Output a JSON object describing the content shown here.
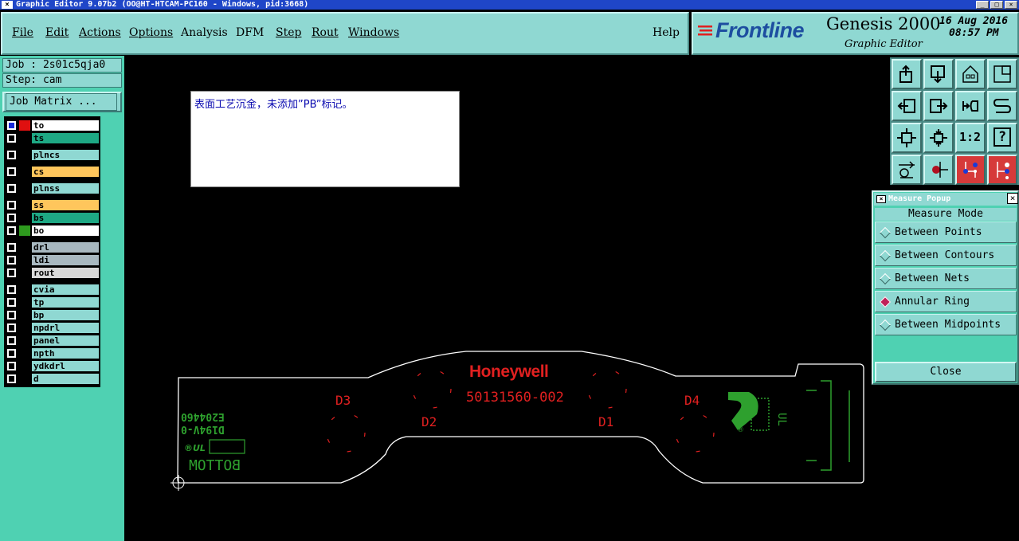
{
  "window": {
    "title": "Graphic Editor 9.07b2 (OO@HT-HTCAM-PC160 - Windows, pid:3668)",
    "controls": [
      "_",
      "□",
      "×"
    ]
  },
  "menu": {
    "items": [
      {
        "label": "File"
      },
      {
        "label": "Edit"
      },
      {
        "label": "Actions"
      },
      {
        "label": "Options"
      },
      {
        "label": "Analysis"
      },
      {
        "label": "DFM"
      },
      {
        "label": "Step"
      },
      {
        "label": "Rout"
      },
      {
        "label": "Windows"
      }
    ],
    "help": "Help"
  },
  "brand": {
    "logo": "Frontline",
    "product": "Genesis 2000",
    "subtitle": "Graphic Editor",
    "date": "16 Aug 2016",
    "time": "08:57 PM"
  },
  "job": {
    "job_label": "Job : 2s01c5qja0",
    "step_label": "Step: cam",
    "matrix_button": "Job Matrix ..."
  },
  "layers": [
    {
      "name": "to",
      "color": "#ffffff",
      "swatch": "#e01010",
      "active": true
    },
    {
      "name": "ts",
      "color": "#1ea884",
      "swatch": ""
    },
    {
      "name": "plncs",
      "color": "#8fd8d2",
      "swatch": ""
    },
    {
      "name": "cs",
      "color": "#ffc65c",
      "swatch": ""
    },
    {
      "name": "plnss",
      "color": "#8fd8d2",
      "swatch": ""
    },
    {
      "name": "ss",
      "color": "#ffc65c",
      "swatch": ""
    },
    {
      "name": "bs",
      "color": "#1ea884",
      "swatch": ""
    },
    {
      "name": "bo",
      "color": "#ffffff",
      "swatch": "#2e9a1e"
    },
    {
      "name": "drl",
      "color": "#a8b8c0",
      "swatch": ""
    },
    {
      "name": "ldi",
      "color": "#a8b8c0",
      "swatch": ""
    },
    {
      "name": "rout",
      "color": "#d8d8d8",
      "swatch": ""
    },
    {
      "name": "cvia",
      "color": "#8fd8d2",
      "swatch": ""
    },
    {
      "name": "tp",
      "color": "#8fd8d2",
      "swatch": ""
    },
    {
      "name": "bp",
      "color": "#8fd8d2",
      "swatch": ""
    },
    {
      "name": "npdrl",
      "color": "#8fd8d2",
      "swatch": ""
    },
    {
      "name": "panel",
      "color": "#8fd8d2",
      "swatch": ""
    },
    {
      "name": "npth",
      "color": "#8fd8d2",
      "swatch": ""
    },
    {
      "name": "ydkdrl",
      "color": "#8fd8d2",
      "swatch": ""
    },
    {
      "name": "d",
      "color": "#8fd8d2",
      "swatch": ""
    }
  ],
  "note": {
    "text": "表面工艺沉金，未添加”PB”标记。"
  },
  "board": {
    "brand_text": "Honeywell",
    "part_number": "50131560-002",
    "ref_d1": "D1",
    "ref_d2": "D2",
    "ref_d3": "D3",
    "ref_d4": "D4",
    "mirror_line1": "E204460",
    "mirror_line2": "D194V-0",
    "mirror_bottom": "BOTTOM",
    "colors": {
      "outline": "#ffffff",
      "silk_top": "#e02020",
      "silk_bottom": "#2ea02e"
    }
  },
  "toolbar": {
    "buttons": [
      {
        "icon": "zoom-home-icon"
      },
      {
        "icon": "zoom-fit-icon"
      },
      {
        "icon": "home-icon"
      },
      {
        "icon": "window-icon"
      },
      {
        "icon": "pan-left-icon"
      },
      {
        "icon": "pan-right-icon"
      },
      {
        "icon": "undo-redo-icon"
      },
      {
        "icon": "swap-icon"
      },
      {
        "icon": "zoom-in-icon"
      },
      {
        "icon": "zoom-out-icon"
      },
      {
        "icon": "ratio-icon",
        "label": "1:2"
      },
      {
        "icon": "help-icon",
        "label": "?"
      },
      {
        "icon": "measure-tool-icon"
      },
      {
        "icon": "snap-icon"
      },
      {
        "icon": "net-red-icon"
      },
      {
        "icon": "net-red-icon-2"
      }
    ]
  },
  "measure_popup": {
    "title": "Measure Popup",
    "mode_label": "Measure Mode",
    "options": [
      {
        "label": "Between Points",
        "selected": false
      },
      {
        "label": "Between Contours",
        "selected": false
      },
      {
        "label": "Between Nets",
        "selected": false
      },
      {
        "label": "Annular Ring",
        "selected": true
      },
      {
        "label": "Between Midpoints",
        "selected": false
      }
    ],
    "close_label": "Close"
  }
}
